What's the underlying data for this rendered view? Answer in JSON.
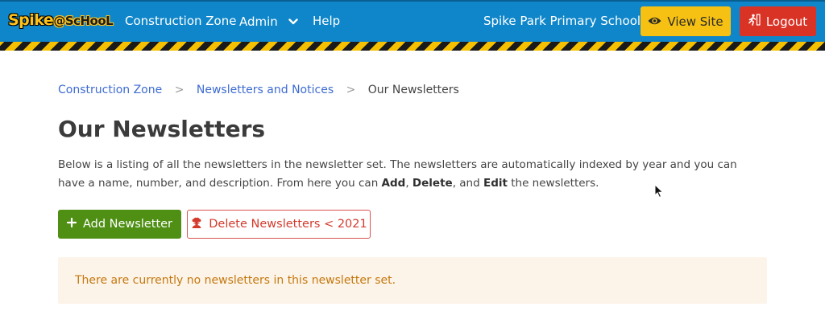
{
  "header": {
    "logo": {
      "part1": "Spike",
      "part2": "@ScHooL"
    },
    "nav": {
      "construction_zone": "Construction Zone",
      "admin": "Admin",
      "help": "Help"
    },
    "school_name": "Spike Park Primary School",
    "view_site_label": "View Site",
    "logout_label": "Logout",
    "colors": {
      "bar": "#0f86c9",
      "view_site": "#f6c112",
      "logout": "#d93326"
    },
    "icons": {
      "view_site": "eye-icon",
      "logout": "running-exit-icon",
      "admin": "chevron-down-icon"
    }
  },
  "breadcrumb": {
    "items": [
      "Construction Zone",
      "Newsletters and Notices"
    ],
    "separator": ">",
    "current": "Our Newsletters"
  },
  "page": {
    "title": "Our Newsletters",
    "intro": {
      "text1": "Below is a listing of all the newsletters in the newsletter set. The newsletters are automatically indexed by year and you can have a name, number, and description. From here you can ",
      "bold_add": "Add",
      "sep1": ", ",
      "bold_delete": "Delete",
      "sep2": ", and ",
      "bold_edit": "Edit",
      "text2": " the newsletters."
    },
    "add_button_label": "Add Newsletter",
    "add_button_icon": "plus-icon",
    "delete_button_label": "Delete Newsletters < 2021",
    "delete_button_icon": "nuke-icon",
    "empty_notice": "There are currently no newsletters in this newsletter set.",
    "colors": {
      "add": "#4e8f14",
      "delete": "#d33a2c",
      "notice_bg": "#fdf4e9",
      "notice_text": "#c4780f"
    }
  }
}
